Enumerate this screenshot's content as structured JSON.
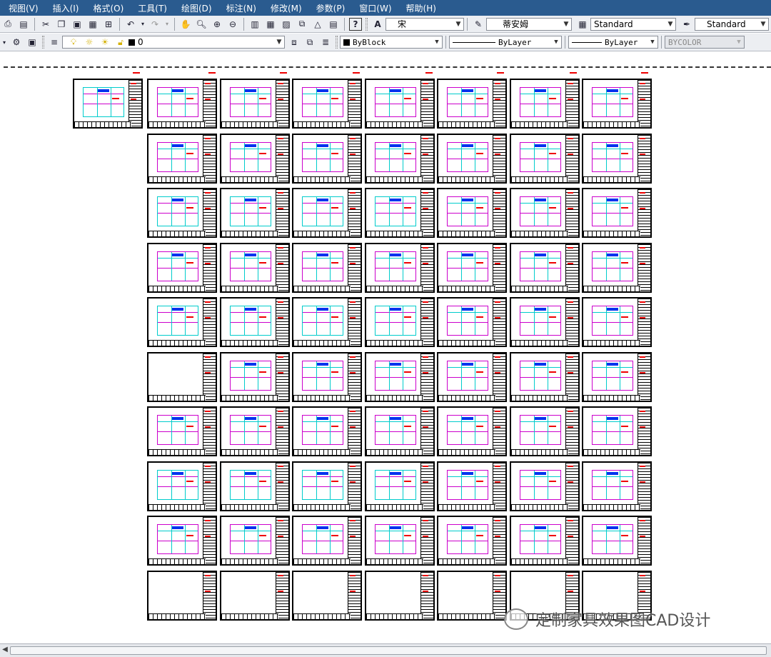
{
  "menu": [
    "视图(V)",
    "插入(I)",
    "格式(O)",
    "工具(T)",
    "绘图(D)",
    "标注(N)",
    "修改(M)",
    "参数(P)",
    "窗口(W)",
    "帮助(H)"
  ],
  "toolbar1": {
    "font_combo": "宋",
    "dim_font_combo": "蒂安姆",
    "text_style_combo": "Standard",
    "dim_style_combo": "Standard"
  },
  "toolbar2": {
    "layer_combo": "0",
    "color_combo": "ByBlock",
    "linetype_combo": "ByLayer",
    "lineweight_combo": "ByLayer",
    "plotstyle_combo": "BYCOLOR"
  },
  "watermark": {
    "text": "定制家具效果图CAD设计"
  },
  "icons": [
    "zoom-icon",
    "cut-icon",
    "copy-icon",
    "paste-icon",
    "undo-icon",
    "redo-icon",
    "help-icon",
    "layer-icon",
    "bulb-icon",
    "sun-icon",
    "lock-icon"
  ]
}
